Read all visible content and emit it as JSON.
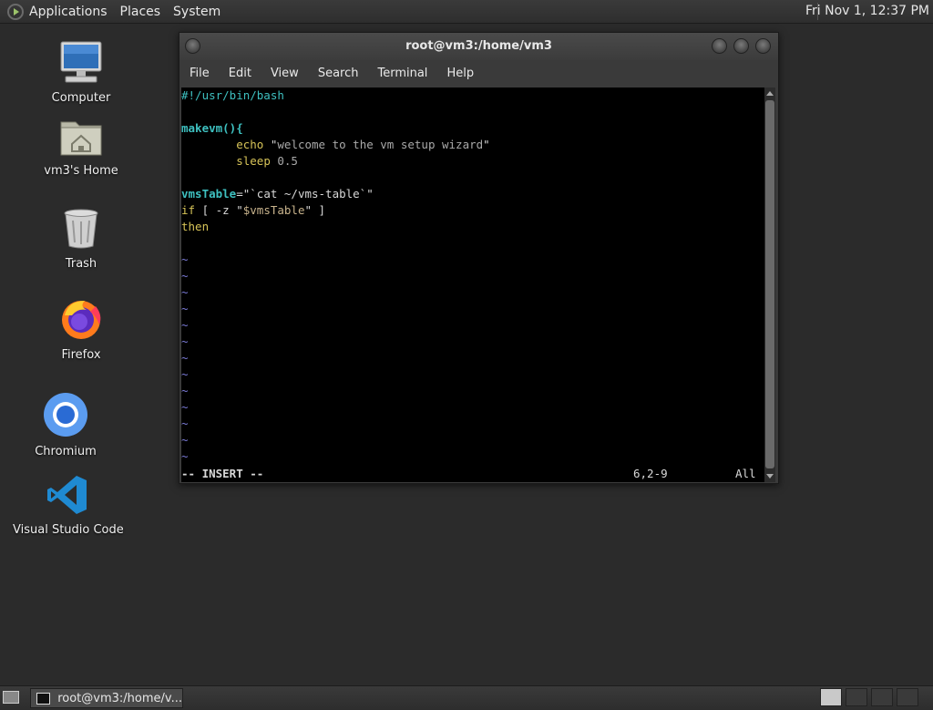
{
  "top_panel": {
    "menus": [
      "Applications",
      "Places",
      "System"
    ],
    "clock": "Fri Nov 1, 12:37 PM"
  },
  "desktop": {
    "icons": [
      {
        "label": "Computer",
        "icon": "computer-icon"
      },
      {
        "label": "vm3's Home",
        "icon": "home-folder-icon"
      },
      {
        "label": "Trash",
        "icon": "trash-icon"
      },
      {
        "label": "Firefox",
        "icon": "firefox-icon"
      },
      {
        "label": "Chromium",
        "icon": "chromium-icon"
      },
      {
        "label": "Visual Studio Code",
        "icon": "vscode-icon"
      }
    ]
  },
  "terminal": {
    "title": "root@vm3:/home/vm3",
    "menu": [
      "File",
      "Edit",
      "View",
      "Search",
      "Terminal",
      "Help"
    ],
    "lines": [
      "#!/usr/bin/bash",
      "",
      "makevm(){",
      "        echo \"welcome to the vm setup wizard\"",
      "        sleep 0.5",
      "",
      "vmsTable=\"`cat ~/vms-table`\"",
      "if [ -z \"$vmsTable\" ]",
      "then",
      "",
      "~",
      "~",
      "~",
      "~",
      "~",
      "~",
      "~",
      "~",
      "~",
      "~",
      "~",
      "~",
      "~"
    ],
    "status_mode": "-- INSERT --",
    "status_position": "6,2-9",
    "status_scroll": "All"
  },
  "taskbar": {
    "task_label": "root@vm3:/home/v..."
  }
}
